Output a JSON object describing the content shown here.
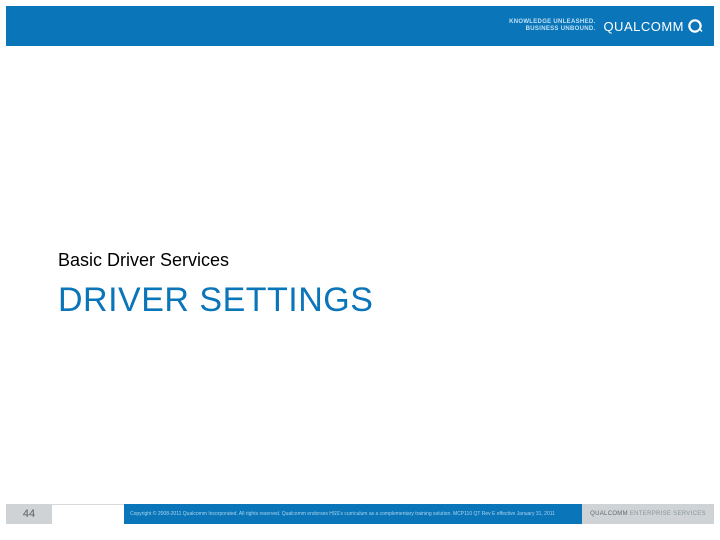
{
  "header": {
    "tagline_line1": "KNOWLEDGE UNLEASHED.",
    "tagline_line2": "BUSINESS UNBOUND.",
    "logo_text": "QUALCOMM"
  },
  "content": {
    "subtitle": "Basic Driver Services",
    "title": "DRIVER SETTINGS"
  },
  "footer": {
    "page_number": "44",
    "copyright": "Copyright © 2008-2011 Qualcomm Incorporated. All rights reserved. Qualcomm endorses HSS's curriculum as a complementary training solution. MCP110 QT Rev E effective January 31, 2011",
    "brand_main": "QUALCOMM",
    "brand_sub": " ENTERPRISE SERVICES"
  },
  "colors": {
    "accent": "#0a75b9",
    "muted": "#cfd3d6"
  }
}
